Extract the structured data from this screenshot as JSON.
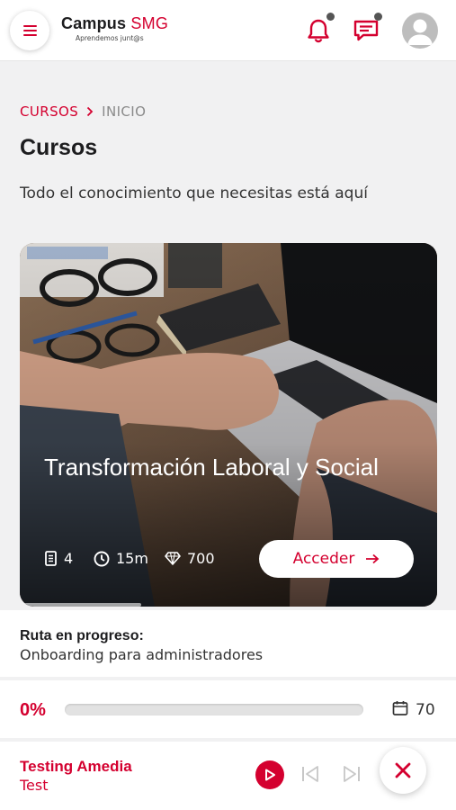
{
  "header": {
    "logo_main": "Campus",
    "logo_accent": "SMG",
    "logo_tagline": "Aprendemos junt@s",
    "icons": [
      "menu-icon",
      "bell-icon",
      "chat-icon",
      "avatar-icon"
    ],
    "accent_color": "#d4002f"
  },
  "breadcrumb": {
    "items": [
      "CURSOS",
      "INICIO"
    ],
    "separator": "›"
  },
  "page": {
    "title": "Cursos",
    "subtitle": "Todo el conocimiento que necesitas está aquí"
  },
  "course_card": {
    "title": "Transformación Laboral y Social",
    "lessons": "4",
    "duration": "15m",
    "points": "700",
    "cta_label": "Acceder",
    "icons": [
      "lessons-icon",
      "clock-icon",
      "diamond-icon",
      "arrow-right-icon"
    ]
  },
  "route": {
    "label": "Ruta en progreso:",
    "name": "Onboarding para administradores",
    "progress_text": "0%",
    "progress_fraction": 0,
    "days": "70"
  },
  "player": {
    "title": "Testing Amedia",
    "subtitle": "Test",
    "icons": [
      "play-icon",
      "skip-back-icon",
      "skip-forward-icon",
      "close-icon"
    ]
  }
}
